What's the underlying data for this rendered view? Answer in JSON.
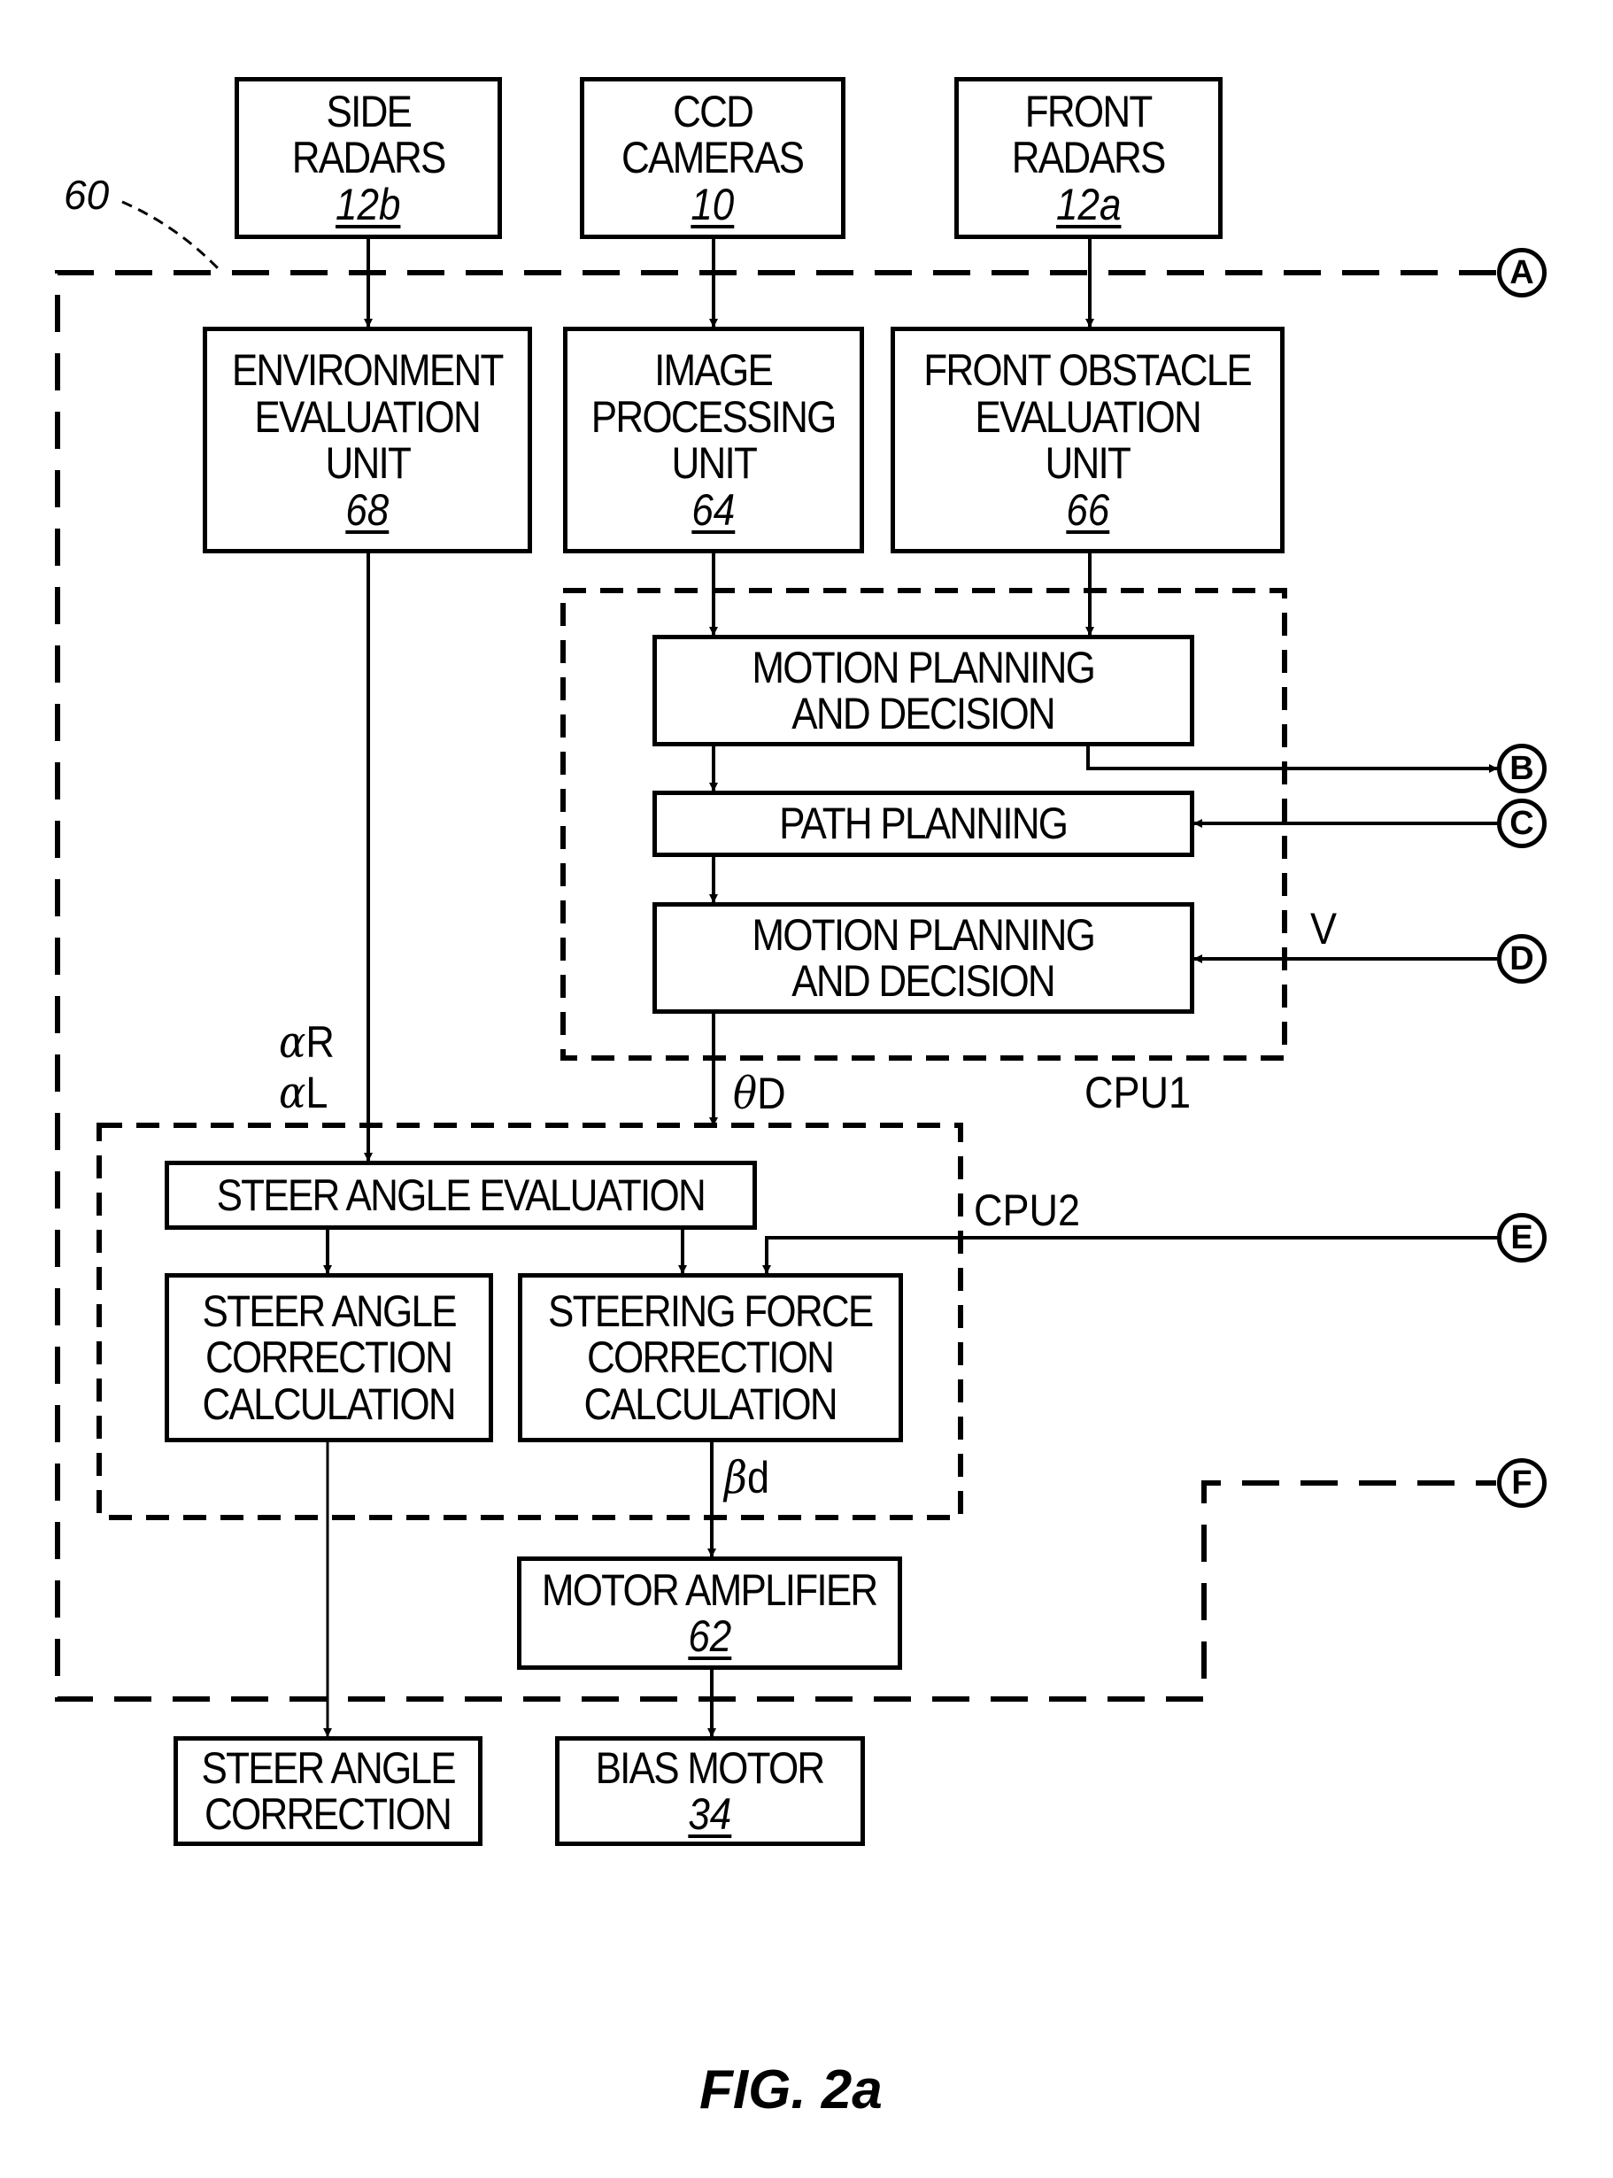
{
  "figure": {
    "caption": "FIG. 2a",
    "system_ref": "60"
  },
  "blocks": {
    "side_radars": {
      "lines": [
        "SIDE",
        "RADARS"
      ],
      "ref": "12b"
    },
    "ccd_cameras": {
      "lines": [
        "CCD",
        "CAMERAS"
      ],
      "ref": "10"
    },
    "front_radars": {
      "lines": [
        "FRONT",
        "RADARS"
      ],
      "ref": "12a"
    },
    "environment_eval": {
      "lines": [
        "ENVIRONMENT",
        "EVALUATION",
        "UNIT"
      ],
      "ref": "68"
    },
    "image_processing": {
      "lines": [
        "IMAGE",
        "PROCESSING",
        "UNIT"
      ],
      "ref": "64"
    },
    "front_obstacle_eval": {
      "lines": [
        "FRONT OBSTACLE",
        "EVALUATION",
        "UNIT"
      ],
      "ref": "66"
    },
    "motion_planning_1": {
      "lines": [
        "MOTION PLANNING",
        "AND DECISION"
      ]
    },
    "path_planning": {
      "lines": [
        "PATH PLANNING"
      ]
    },
    "motion_planning_2": {
      "lines": [
        "MOTION PLANNING",
        "AND DECISION"
      ]
    },
    "steer_angle_eval": {
      "lines": [
        "STEER ANGLE EVALUATION"
      ]
    },
    "steer_angle_corr_calc": {
      "lines": [
        "STEER ANGLE",
        "CORRECTION",
        "CALCULATION"
      ]
    },
    "steering_force_corr_calc": {
      "lines": [
        "STEERING FORCE",
        "CORRECTION",
        "CALCULATION"
      ]
    },
    "motor_amplifier": {
      "lines": [
        "MOTOR AMPLIFIER"
      ],
      "ref": "62"
    },
    "steer_angle_correction": {
      "lines": [
        "STEER ANGLE",
        "CORRECTION"
      ]
    },
    "bias_motor": {
      "lines": [
        "BIAS MOTOR"
      ],
      "ref": "34"
    }
  },
  "groups": {
    "cpu1": "CPU1",
    "cpu2": "CPU2"
  },
  "signals": {
    "alpha_r": {
      "sym": "α",
      "txt": "R"
    },
    "alpha_l": {
      "sym": "α",
      "txt": "L"
    },
    "theta_d": {
      "sym": "θ",
      "txt": "D"
    },
    "beta_d": {
      "sym": "β",
      "txt": "d"
    },
    "v": "V"
  },
  "connectors": [
    "A",
    "B",
    "C",
    "D",
    "E",
    "F"
  ]
}
